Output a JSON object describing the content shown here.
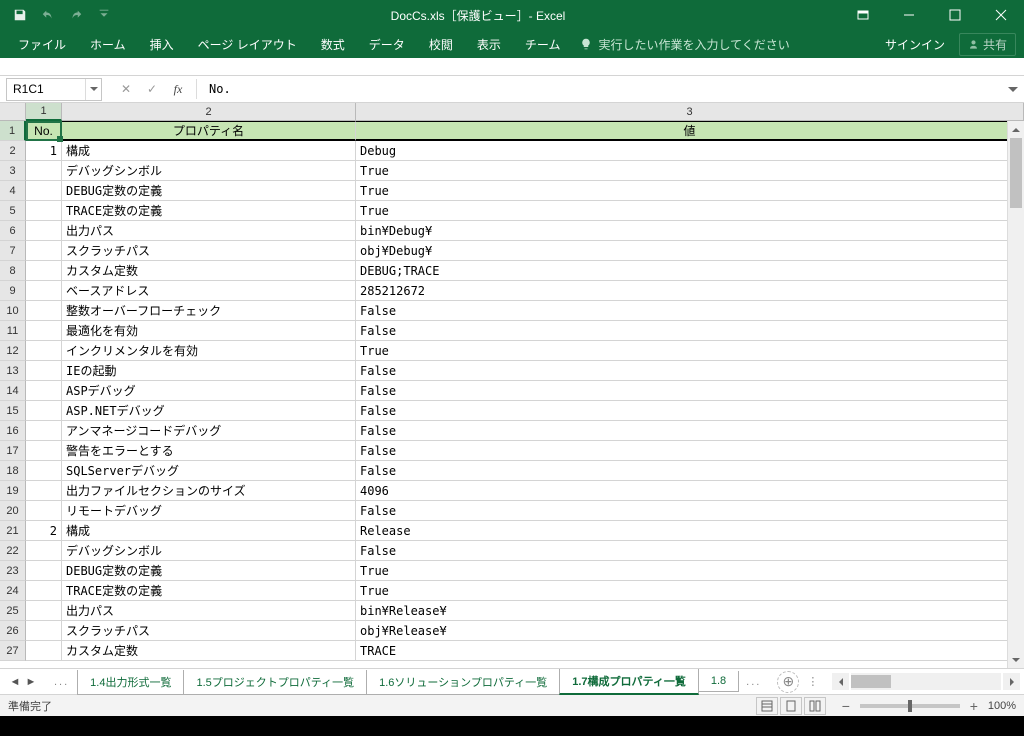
{
  "title": "DocCs.xls［保護ビュー］- Excel",
  "ribbon": {
    "tabs": [
      "ファイル",
      "ホーム",
      "挿入",
      "ページ レイアウト",
      "数式",
      "データ",
      "校閲",
      "表示",
      "チーム"
    ],
    "tellme": "実行したい作業を入力してください",
    "signin": "サインイン",
    "share": "共有"
  },
  "nameBox": "R1C1",
  "formula": "No.",
  "colNumbers": [
    "1",
    "2",
    "3"
  ],
  "headerRow": {
    "no": "No.",
    "prop": "プロパティ名",
    "val": "値"
  },
  "rows": [
    {
      "r": "2",
      "no": "1",
      "p": "構成",
      "v": "Debug"
    },
    {
      "r": "3",
      "no": "",
      "p": "デバッグシンボル",
      "v": "True"
    },
    {
      "r": "4",
      "no": "",
      "p": "DEBUG定数の定義",
      "v": "True"
    },
    {
      "r": "5",
      "no": "",
      "p": "TRACE定数の定義",
      "v": "True"
    },
    {
      "r": "6",
      "no": "",
      "p": "出力パス",
      "v": "bin¥Debug¥"
    },
    {
      "r": "7",
      "no": "",
      "p": "スクラッチパス",
      "v": "obj¥Debug¥"
    },
    {
      "r": "8",
      "no": "",
      "p": "カスタム定数",
      "v": "DEBUG;TRACE"
    },
    {
      "r": "9",
      "no": "",
      "p": "ベースアドレス",
      "v": "285212672"
    },
    {
      "r": "10",
      "no": "",
      "p": "整数オーバーフローチェック",
      "v": "False"
    },
    {
      "r": "11",
      "no": "",
      "p": "最適化を有効",
      "v": "False"
    },
    {
      "r": "12",
      "no": "",
      "p": "インクリメンタルを有効",
      "v": "True"
    },
    {
      "r": "13",
      "no": "",
      "p": "IEの起動",
      "v": "False"
    },
    {
      "r": "14",
      "no": "",
      "p": "ASPデバッグ",
      "v": "False"
    },
    {
      "r": "15",
      "no": "",
      "p": "ASP.NETデバッグ",
      "v": "False"
    },
    {
      "r": "16",
      "no": "",
      "p": "アンマネージコードデバッグ",
      "v": "False"
    },
    {
      "r": "17",
      "no": "",
      "p": "警告をエラーとする",
      "v": "False"
    },
    {
      "r": "18",
      "no": "",
      "p": "SQLServerデバッグ",
      "v": "False"
    },
    {
      "r": "19",
      "no": "",
      "p": "出力ファイルセクションのサイズ",
      "v": "4096"
    },
    {
      "r": "20",
      "no": "",
      "p": "リモートデバッグ",
      "v": "False"
    },
    {
      "r": "21",
      "no": "2",
      "p": "構成",
      "v": "Release"
    },
    {
      "r": "22",
      "no": "",
      "p": "デバッグシンボル",
      "v": "False"
    },
    {
      "r": "23",
      "no": "",
      "p": "DEBUG定数の定義",
      "v": "True"
    },
    {
      "r": "24",
      "no": "",
      "p": "TRACE定数の定義",
      "v": "True"
    },
    {
      "r": "25",
      "no": "",
      "p": "出力パス",
      "v": "bin¥Release¥"
    },
    {
      "r": "26",
      "no": "",
      "p": "スクラッチパス",
      "v": "obj¥Release¥"
    },
    {
      "r": "27",
      "no": "",
      "p": "カスタム定数",
      "v": "TRACE"
    }
  ],
  "sheets": {
    "ellipsis": "...",
    "tabs": [
      "1.4出力形式一覧",
      "1.5プロジェクトプロパティ一覧",
      "1.6ソリューションプロパティ一覧",
      "1.7構成プロパティ一覧"
    ],
    "trunc": "1.8",
    "active": 3
  },
  "status": {
    "ready": "準備完了",
    "zoom": "100%"
  }
}
